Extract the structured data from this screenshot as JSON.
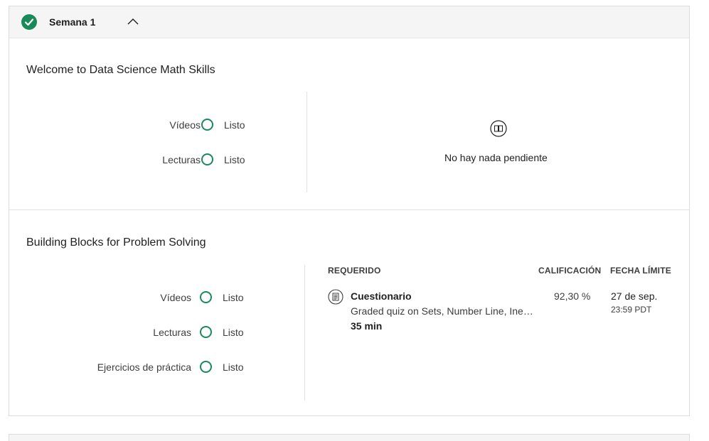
{
  "week": {
    "title": "Semana 1",
    "colors": {
      "accent": "#1a8a5a",
      "header_bg": "#f5f5f5"
    }
  },
  "modules": [
    {
      "title": "Welcome to Data Science Math Skills",
      "progress": [
        {
          "label": "Vídeos",
          "status": "Listo"
        },
        {
          "label": "Lecturas",
          "status": "Listo"
        }
      ],
      "empty_state": {
        "icon": "book-icon",
        "text": "No hay nada pendiente"
      }
    },
    {
      "title": "Building Blocks for Problem Solving",
      "progress": [
        {
          "label": "Vídeos",
          "status": "Listo"
        },
        {
          "label": "Lecturas",
          "status": "Listo"
        },
        {
          "label": "Ejercicios de práctica",
          "status": "Listo"
        }
      ],
      "table": {
        "headers": {
          "required": "REQUERIDO",
          "grade": "CALIFICACIÓN",
          "due": "FECHA LÍMITE"
        },
        "items": [
          {
            "icon": "quiz-icon",
            "type": "Cuestionario",
            "name": "Graded quiz on Sets, Number Line, Inequalities, Simplification, and Sigma Notation",
            "duration": "35 min",
            "grade": "92,30 %",
            "due_date": "27 de sep.",
            "due_time": "23:59 PDT"
          }
        ]
      }
    }
  ]
}
